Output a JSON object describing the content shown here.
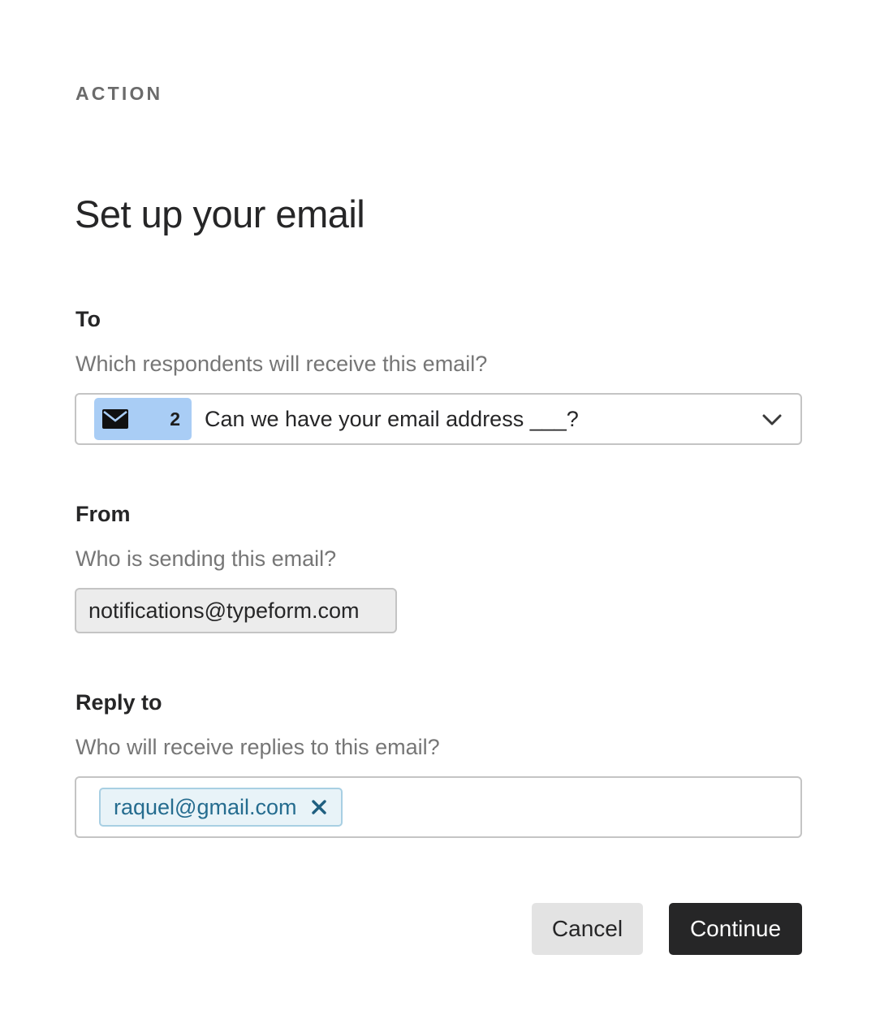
{
  "header": {
    "eyebrow": "ACTION",
    "title": "Set up your email"
  },
  "to": {
    "label": "To",
    "help": "Which respondents will receive this email?",
    "selected": {
      "icon": "envelope-icon",
      "question_number": "2",
      "question_text": "Can we have your email address ___?"
    },
    "dropdown_icon": "chevron-down-icon"
  },
  "from": {
    "label": "From",
    "help": "Who is sending this email?",
    "value": "notifications@typeform.com"
  },
  "reply_to": {
    "label": "Reply to",
    "help": "Who will receive replies to this email?",
    "chips": [
      {
        "email": "raquel@gmail.com",
        "remove_icon": "close-icon"
      }
    ]
  },
  "actions": {
    "cancel_label": "Cancel",
    "continue_label": "Continue"
  },
  "colors": {
    "badge_background": "#a9cdf5",
    "chip_background": "#e8f3f8",
    "chip_border": "#a8cfe3",
    "chip_text": "#256c8f",
    "primary_button": "#262627",
    "secondary_button": "#e3e3e3"
  }
}
